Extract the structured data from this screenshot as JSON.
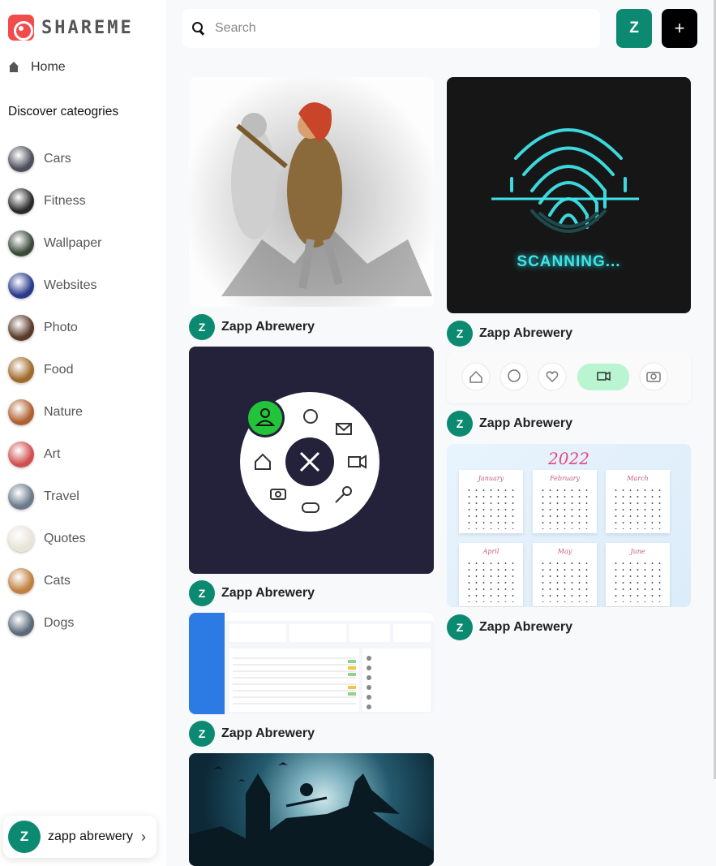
{
  "app": {
    "brand": "SHAREME"
  },
  "nav": {
    "home_label": "Home",
    "discover_label": "Discover cateogries"
  },
  "categories": [
    {
      "label": "Cars",
      "color": "#4a4f5a"
    },
    {
      "label": "Fitness",
      "color": "#2a2a2a"
    },
    {
      "label": "Wallpaper",
      "color": "#3a4a3a"
    },
    {
      "label": "Websites",
      "color": "#2a3a8a"
    },
    {
      "label": "Photo",
      "color": "#5a3a2a"
    },
    {
      "label": "Food",
      "color": "#a06a2a"
    },
    {
      "label": "Nature",
      "color": "#b06030"
    },
    {
      "label": "Art",
      "color": "#d05050"
    },
    {
      "label": "Travel",
      "color": "#6a7a8a"
    },
    {
      "label": "Quotes",
      "color": "#e8e4d8"
    },
    {
      "label": "Cats",
      "color": "#c08040"
    },
    {
      "label": "Dogs",
      "color": "#5a6a7a"
    }
  ],
  "search": {
    "placeholder": "Search"
  },
  "header": {
    "avatar_initial": "Z",
    "add_label": "+"
  },
  "user": {
    "initial": "Z",
    "name": "zapp abrewery",
    "chevron": "›"
  },
  "pins": [
    {
      "author_initial": "Z",
      "author": "Zapp Abrewery"
    },
    {
      "author_initial": "Z",
      "author": "Zapp Abrewery",
      "overlay_text": "SCANNING..."
    },
    {
      "author_initial": "Z",
      "author": "Zapp Abrewery"
    },
    {
      "author_initial": "Z",
      "author": "Zapp Abrewery"
    },
    {
      "author_initial": "Z",
      "author": "Zapp Abrewery",
      "overlay_text": "2022",
      "months": [
        "January",
        "February",
        "March",
        "April",
        "May",
        "June"
      ]
    },
    {
      "author_initial": "Z",
      "author": "Zapp Abrewery"
    }
  ],
  "colors": {
    "accent": "#0c8a71",
    "scan_glow": "#3fe3e9",
    "calendar_year": "#e5487e",
    "menu_active": "#22c53a"
  }
}
